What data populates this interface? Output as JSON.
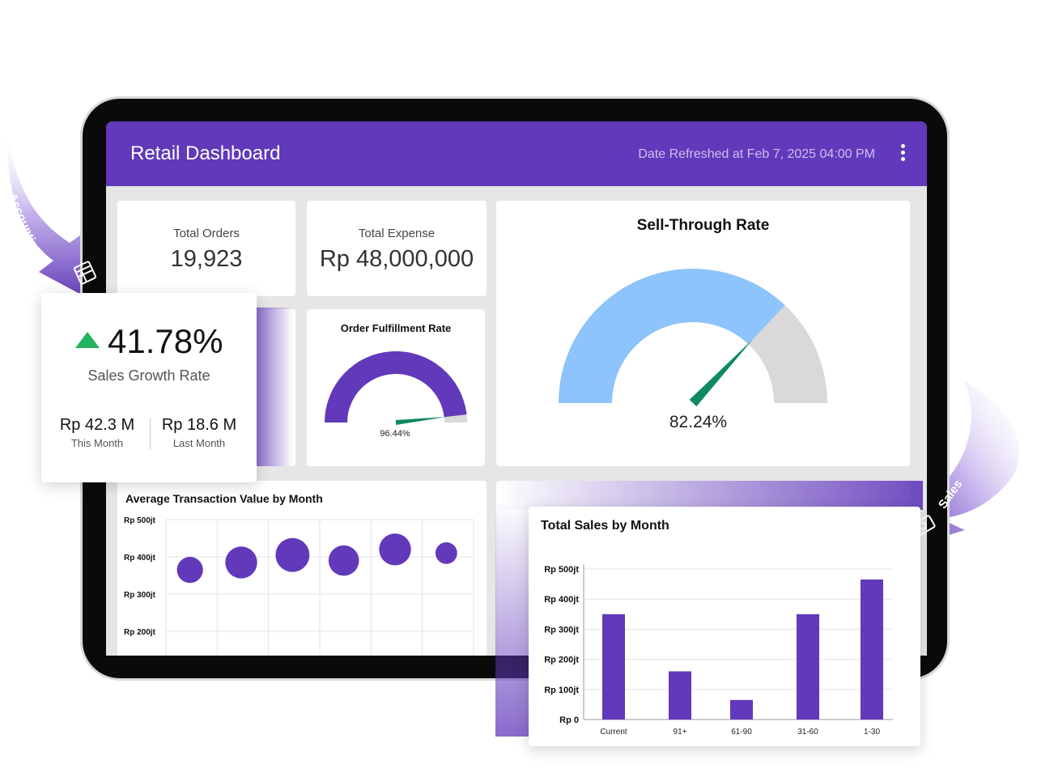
{
  "header": {
    "title": "Retail Dashboard",
    "refreshed": "Date Refreshed at Feb 7, 2025 04:00 PM",
    "menu_icon": "kebab-menu-icon"
  },
  "kpis": {
    "total_orders_label": "Total Orders",
    "total_orders_value": "19,923",
    "total_expense_label": "Total Expense",
    "total_expense_value": "Rp 48,000,000"
  },
  "order_fulfillment": {
    "title": "Order Fulfillment Rate",
    "value_label": "96.44%",
    "value": 0.9644,
    "fill_color": "#6139ba",
    "track_color": "#d9d9d9",
    "needle_color": "#0f8a5f"
  },
  "sell_through": {
    "title": "Sell-Through Rate",
    "value_label": "82.24%",
    "value": 0.8224,
    "indicator_fraction": 0.74,
    "fill_color": "#8cc4fb",
    "track_color": "#d9d9d9",
    "needle_color": "#0f8a5f"
  },
  "sales_growth": {
    "value": "41.78%",
    "label": "Sales Growth Rate",
    "this_month_value": "Rp 42.3 M",
    "this_month_label": "This Month",
    "last_month_value": "Rp 18.6 M",
    "last_month_label": "Last Month",
    "trend_icon": "arrow-up-icon",
    "trend_color": "#22b35e"
  },
  "callouts": {
    "accounting": "Accounting",
    "accounting_icon": "ledger-icon",
    "sales": "Sales",
    "sales_icon": "cash-icon"
  },
  "chart_data": [
    {
      "type": "scatter",
      "title": "Average Transaction Value by Month",
      "y_ticks": [
        "Rp 500jt",
        "Rp 400jt",
        "Rp 300jt",
        "Rp 200jt"
      ],
      "ylim": [
        200,
        500
      ],
      "points": [
        {
          "y": 365,
          "size": 0.45
        },
        {
          "y": 385,
          "size": 0.65
        },
        {
          "y": 405,
          "size": 0.72
        },
        {
          "y": 390,
          "size": 0.6
        },
        {
          "y": 420,
          "size": 0.65
        },
        {
          "y": 410,
          "size": 0.3
        }
      ],
      "grid": true,
      "color": "#6139ba"
    },
    {
      "type": "bar",
      "title": "Total Sales by Month",
      "categories": [
        "Current",
        "91+",
        "61-90",
        "31-60",
        "1-30"
      ],
      "values": [
        350,
        160,
        65,
        350,
        465
      ],
      "y_ticks": [
        "Rp 500jt",
        "Rp 400jt",
        "Rp 300jt",
        "Rp 200jt",
        "Rp 100jt",
        "Rp 0"
      ],
      "ylim": [
        0,
        500
      ],
      "grid": true,
      "color": "#6139ba"
    }
  ]
}
